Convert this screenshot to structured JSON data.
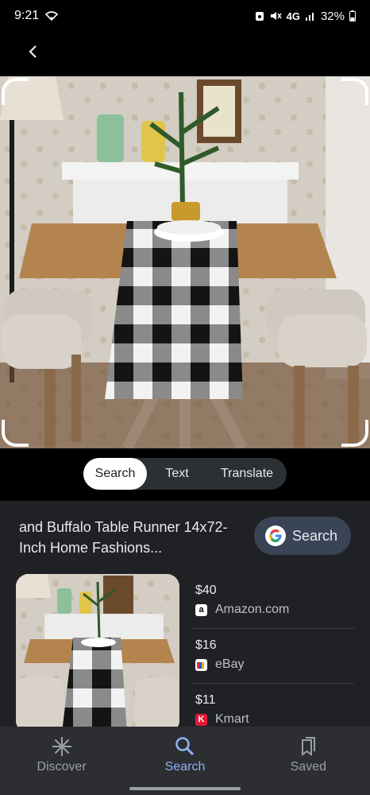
{
  "status": {
    "time": "9:21",
    "network": "4G",
    "battery": "32%"
  },
  "modes": {
    "search": "Search",
    "text": "Text",
    "translate": "Translate",
    "active": "Search"
  },
  "result": {
    "title": "and Buffalo Table Runner 14x72-Inch Home Fashions...",
    "search_button": "Search"
  },
  "offers": [
    {
      "price": "$40",
      "store": "Amazon.com",
      "logo_letter": "a",
      "logo_bg": "#ffffff",
      "logo_fg": "#000000"
    },
    {
      "price": "$16",
      "store": "eBay",
      "logo_letter": "e",
      "logo_bg": "#ffffff",
      "logo_fg": "#e53238"
    },
    {
      "price": "$11",
      "store": "Kmart",
      "logo_letter": "K",
      "logo_bg": "#e41937",
      "logo_fg": "#ffffff"
    }
  ],
  "nav": {
    "discover": "Discover",
    "search": "Search",
    "saved": "Saved",
    "active": "Search"
  },
  "colors": {
    "accent": "#8ab4f8",
    "sheet_bg": "#202124",
    "nav_bg": "#2d2e31"
  }
}
